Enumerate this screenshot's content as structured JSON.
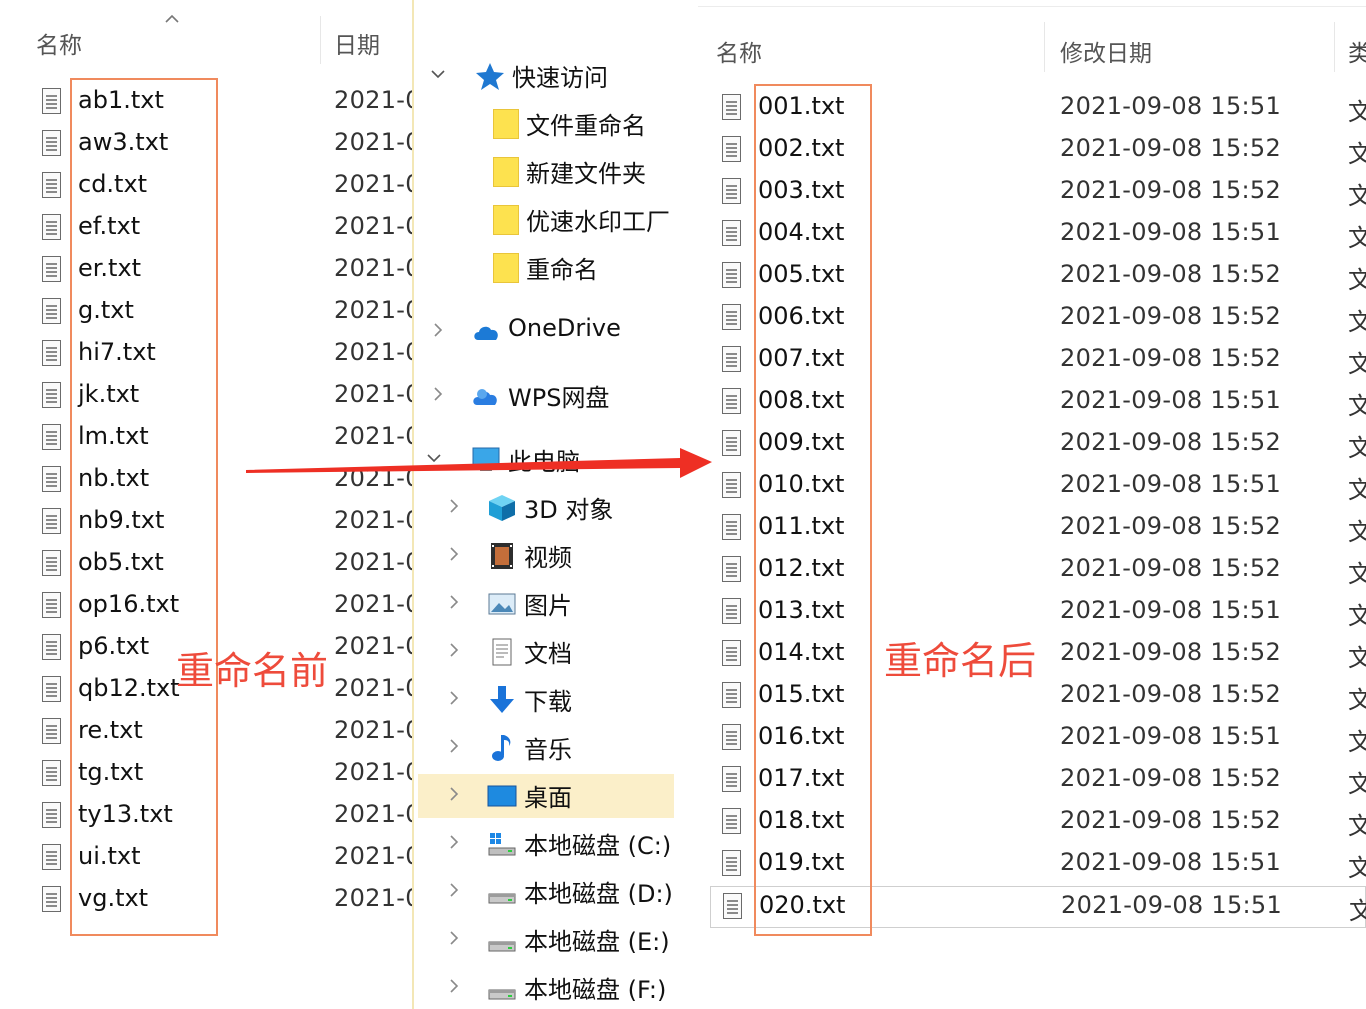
{
  "left": {
    "header_name": "名称",
    "header_date": "日期",
    "files": [
      "ab1.txt",
      "aw3.txt",
      "cd.txt",
      "ef.txt",
      "er.txt",
      "g.txt",
      "hi7.txt",
      "jk.txt",
      "lm.txt",
      "nb.txt",
      "nb9.txt",
      "ob5.txt",
      "op16.txt",
      "p6.txt",
      "qb12.txt",
      "re.txt",
      "tg.txt",
      "ty13.txt",
      "ui.txt",
      "vg.txt"
    ],
    "date_stub": "2021-0",
    "annotation": "重命名前"
  },
  "nav": {
    "items": [
      {
        "label": "快速访问",
        "icon": "star-icon",
        "chevron": "expanded"
      },
      {
        "label": "文件重命名",
        "icon": "folder-icon",
        "chevron": ""
      },
      {
        "label": "新建文件夹",
        "icon": "folder-icon",
        "chevron": ""
      },
      {
        "label": "优速水印工厂",
        "icon": "folder-icon",
        "chevron": ""
      },
      {
        "label": "重命名",
        "icon": "folder-icon",
        "chevron": ""
      },
      {
        "label": "OneDrive",
        "icon": "cloud-icon",
        "chevron": "collapsed"
      },
      {
        "label": "WPS网盘",
        "icon": "wps-cloud-icon",
        "chevron": "collapsed"
      },
      {
        "label": "此电脑",
        "icon": "computer-icon",
        "chevron": "expanded"
      },
      {
        "label": "3D 对象",
        "icon": "cube-3d-icon",
        "chevron": "collapsed"
      },
      {
        "label": "视频",
        "icon": "film-icon",
        "chevron": "collapsed"
      },
      {
        "label": "图片",
        "icon": "picture-icon",
        "chevron": "collapsed"
      },
      {
        "label": "文档",
        "icon": "document-icon",
        "chevron": "collapsed"
      },
      {
        "label": "下载",
        "icon": "download-arrow-icon",
        "chevron": "collapsed"
      },
      {
        "label": "音乐",
        "icon": "music-note-icon",
        "chevron": "collapsed"
      },
      {
        "label": "桌面",
        "icon": "desktop-icon",
        "chevron": "collapsed",
        "selected": true
      },
      {
        "label": "本地磁盘 (C:)",
        "icon": "drive-windows-icon",
        "chevron": "collapsed"
      },
      {
        "label": "本地磁盘 (D:)",
        "icon": "drive-icon",
        "chevron": "collapsed"
      },
      {
        "label": "本地磁盘 (E:)",
        "icon": "drive-icon",
        "chevron": "collapsed"
      },
      {
        "label": "本地磁盘 (F:)",
        "icon": "drive-icon",
        "chevron": "collapsed"
      }
    ]
  },
  "right": {
    "header_name": "名称",
    "header_date": "修改日期",
    "header_type": "类",
    "files": [
      {
        "name": "001.txt",
        "date": "2021-09-08 15:51",
        "type": "文"
      },
      {
        "name": "002.txt",
        "date": "2021-09-08 15:52",
        "type": "文"
      },
      {
        "name": "003.txt",
        "date": "2021-09-08 15:52",
        "type": "文"
      },
      {
        "name": "004.txt",
        "date": "2021-09-08 15:51",
        "type": "文"
      },
      {
        "name": "005.txt",
        "date": "2021-09-08 15:52",
        "type": "文"
      },
      {
        "name": "006.txt",
        "date": "2021-09-08 15:52",
        "type": "文"
      },
      {
        "name": "007.txt",
        "date": "2021-09-08 15:52",
        "type": "文"
      },
      {
        "name": "008.txt",
        "date": "2021-09-08 15:51",
        "type": "文"
      },
      {
        "name": "009.txt",
        "date": "2021-09-08 15:52",
        "type": "文"
      },
      {
        "name": "010.txt",
        "date": "2021-09-08 15:51",
        "type": "文"
      },
      {
        "name": "011.txt",
        "date": "2021-09-08 15:52",
        "type": "文"
      },
      {
        "name": "012.txt",
        "date": "2021-09-08 15:52",
        "type": "文"
      },
      {
        "name": "013.txt",
        "date": "2021-09-08 15:51",
        "type": "文"
      },
      {
        "name": "014.txt",
        "date": "2021-09-08 15:52",
        "type": "文"
      },
      {
        "name": "015.txt",
        "date": "2021-09-08 15:52",
        "type": "文"
      },
      {
        "name": "016.txt",
        "date": "2021-09-08 15:51",
        "type": "文"
      },
      {
        "name": "017.txt",
        "date": "2021-09-08 15:52",
        "type": "文"
      },
      {
        "name": "018.txt",
        "date": "2021-09-08 15:52",
        "type": "文"
      },
      {
        "name": "019.txt",
        "date": "2021-09-08 15:51",
        "type": "文"
      },
      {
        "name": "020.txt",
        "date": "2021-09-08 15:51",
        "type": "文",
        "selected": true
      }
    ],
    "annotation": "重命名后"
  },
  "colors": {
    "annotation": "#ee4b3b",
    "highlight_box": "#f08a5d",
    "arrow": "#ee2f24",
    "nav_selected": "#fbefc9",
    "folder": "#fde24f"
  }
}
